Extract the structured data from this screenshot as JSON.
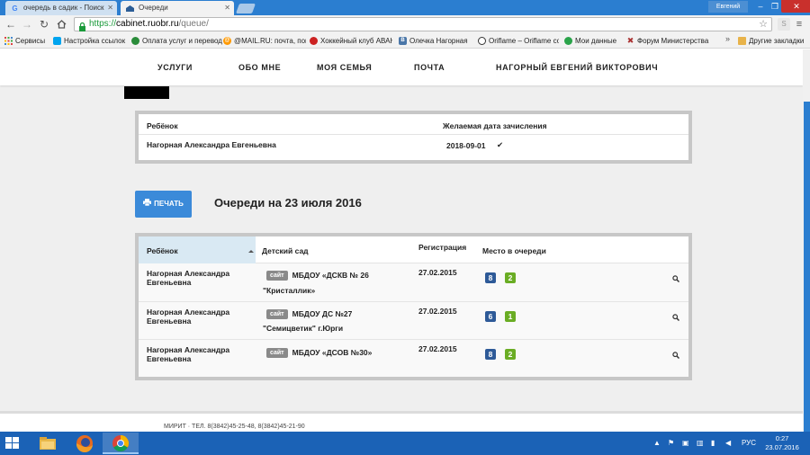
{
  "browser": {
    "tabs": [
      {
        "title": "очередь в садик - Поиск"
      },
      {
        "title": "Очереди"
      }
    ],
    "user": "Евгений",
    "window_controls": {
      "minimize": "–",
      "maximize": "❐",
      "close": "✕"
    },
    "url": {
      "scheme": "https://",
      "host": "cabinet.ruobr.ru",
      "path": "/queue/"
    },
    "bookmarks": [
      "Сервисы",
      "Настройка ссылок",
      "Оплата услуг и перевод",
      "@MAIL.RU: почта, поиск",
      "Хоккейный клуб АВАНГАРД",
      "Олечка Нагорная",
      "Oriflame – Oriflame cosmetics",
      "Мои данные",
      "Форум Министерства",
      "Другие закладки"
    ],
    "bookmarks_more": "»"
  },
  "nav": {
    "items": [
      "УСЛУГИ",
      "ОБО МНЕ",
      "МОЯ СЕМЬЯ",
      "ПОЧТА",
      "НАГОРНЫЙ ЕВГЕНИЙ ВИКТОРОВИЧ"
    ]
  },
  "child_table": {
    "headers": {
      "child": "Ребёнок",
      "date": "Желаемая дата зачисления"
    },
    "rows": [
      {
        "child": "Нагорная Александра Евгеньевна",
        "date": "2018-09-01",
        "check": "✔"
      }
    ]
  },
  "print_button": {
    "label": "ПЕЧАТЬ"
  },
  "queue_title": "Очереди на 23 июля 2016",
  "queue_table": {
    "headers": {
      "child": "Ребёнок",
      "kindergarten": "Детский сад",
      "registration": "Регистрация",
      "place": "Место в очереди"
    },
    "site_label": "сайт",
    "rows": [
      {
        "child": "Нагорная Александра Евгеньевна",
        "kindergarten_line1": "МБДОУ «ДСКВ № 26",
        "kindergarten_line2": "\"Кристаллик»",
        "registration": "27.02.2015",
        "place_a": "8",
        "place_b": "2"
      },
      {
        "child": "Нагорная Александра Евгеньевна",
        "kindergarten_line1": "МБДОУ ДС №27",
        "kindergarten_line2": "\"Семицветик\" г.Юрги",
        "registration": "27.02.2015",
        "place_a": "6",
        "place_b": "1"
      },
      {
        "child": "Нагорная Александра Евгеньевна",
        "kindergarten_line1": "МБДОУ «ДСОВ №30»",
        "kindergarten_line2": "",
        "registration": "27.02.2015",
        "place_a": "8",
        "place_b": "2"
      }
    ]
  },
  "footer": {
    "text": "МИРИТ · ТЕЛ. 8(3842)45-25-48, 8(3842)45-21-90"
  },
  "taskbar": {
    "tray_lang": "РУС",
    "time": "0:27",
    "date": "23.07.2016"
  },
  "colors": {
    "accent": "#3b8ad9",
    "badge_blue": "#2e5a98",
    "badge_green": "#6aad24",
    "taskbar": "#1b62b6"
  }
}
